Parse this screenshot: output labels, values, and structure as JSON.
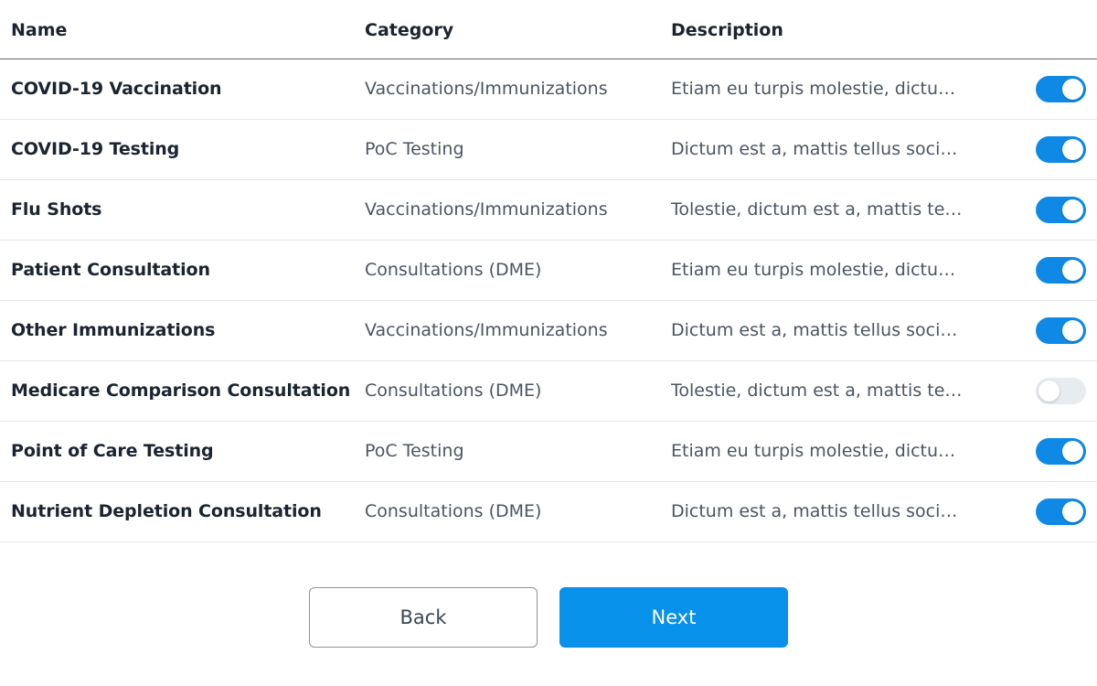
{
  "table": {
    "headers": {
      "name": "Name",
      "category": "Category",
      "description": "Description"
    },
    "rows": [
      {
        "name": "COVID-19 Vaccination",
        "category": "Vaccinations/Immunizations",
        "description": "Etiam eu turpis molestie, dictum...",
        "enabled": true
      },
      {
        "name": "COVID-19 Testing",
        "category": "PoC Testing",
        "description": "Dictum est a, mattis tellus socio...",
        "enabled": true
      },
      {
        "name": "Flu Shots",
        "category": "Vaccinations/Immunizations",
        "description": "Tolestie, dictum est a, mattis tell...",
        "enabled": true
      },
      {
        "name": "Patient Consultation",
        "category": "Consultations (DME)",
        "description": "Etiam eu turpis molestie, dictum...",
        "enabled": true
      },
      {
        "name": "Other Immunizations",
        "category": "Vaccinations/Immunizations",
        "description": "Dictum est a, mattis tellus socio...",
        "enabled": true
      },
      {
        "name": "Medicare Comparison Consultation",
        "category": "Consultations (DME)",
        "description": "Tolestie, dictum est a, mattis tell...",
        "enabled": false
      },
      {
        "name": "Point of Care Testing",
        "category": "PoC Testing",
        "description": "Etiam eu turpis molestie, dictum...",
        "enabled": true
      },
      {
        "name": "Nutrient Depletion Consultation",
        "category": "Consultations (DME)",
        "description": "Dictum est a, mattis tellus socio...",
        "enabled": true
      }
    ]
  },
  "actions": {
    "back_label": "Back",
    "next_label": "Next"
  },
  "colors": {
    "accent": "#0791eb",
    "toggle_on": "#0e8ae6",
    "toggle_off": "#e8ecef"
  }
}
